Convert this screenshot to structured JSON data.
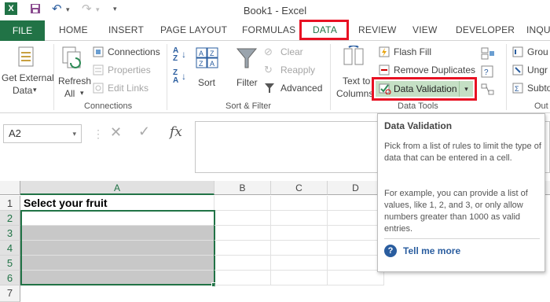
{
  "titlebar": {
    "title": "Book1 - Excel"
  },
  "tabs": {
    "file": "FILE",
    "home": "HOME",
    "insert": "INSERT",
    "page_layout": "PAGE LAYOUT",
    "formulas": "FORMULAS",
    "data": "DATA",
    "review": "REVIEW",
    "view": "VIEW",
    "developer": "DEVELOPER",
    "inquire": "INQU"
  },
  "ribbon": {
    "get_external_data": {
      "line1": "Get External",
      "line2": "Data"
    },
    "refresh_all": {
      "line1": "Refresh",
      "line2": "All"
    },
    "connections": "Connections",
    "properties": "Properties",
    "edit_links": "Edit Links",
    "connections_group": "Connections",
    "sort": "Sort",
    "filter": "Filter",
    "clear": "Clear",
    "reapply": "Reapply",
    "advanced": "Advanced",
    "sort_filter_group": "Sort & Filter",
    "text_to_columns": {
      "line1": "Text to",
      "line2": "Columns"
    },
    "flash_fill": "Flash Fill",
    "remove_duplicates": "Remove Duplicates",
    "data_validation": "Data Validation",
    "data_tools_group": "Data Tools",
    "group": "Grou",
    "ungroup": "Ungr",
    "subtotal": "Subto",
    "outline_group": "Out",
    "sort_az_icon": "A Z",
    "sort_za_icon": "Z A"
  },
  "formula_bar": {
    "name_box": "A2",
    "fx": "fx"
  },
  "grid": {
    "columns": [
      "A",
      "B",
      "C",
      "D"
    ],
    "rows": [
      "1",
      "2",
      "3",
      "4",
      "5",
      "6",
      "7"
    ],
    "a1": "Select your fruit"
  },
  "tooltip": {
    "title": "Data Validation",
    "para1": "Pick from a list of rules to limit the type of data that can be entered in a cell.",
    "para2": "For example, you can provide a list of values, like 1, 2, and 3, or only allow numbers greater than 1000 as valid entries.",
    "link": "Tell me more"
  },
  "colors": {
    "excel_green": "#217346",
    "highlight_red": "#e81123",
    "selection_gray": "#c8c8c8",
    "link_blue": "#2a5d9f"
  }
}
